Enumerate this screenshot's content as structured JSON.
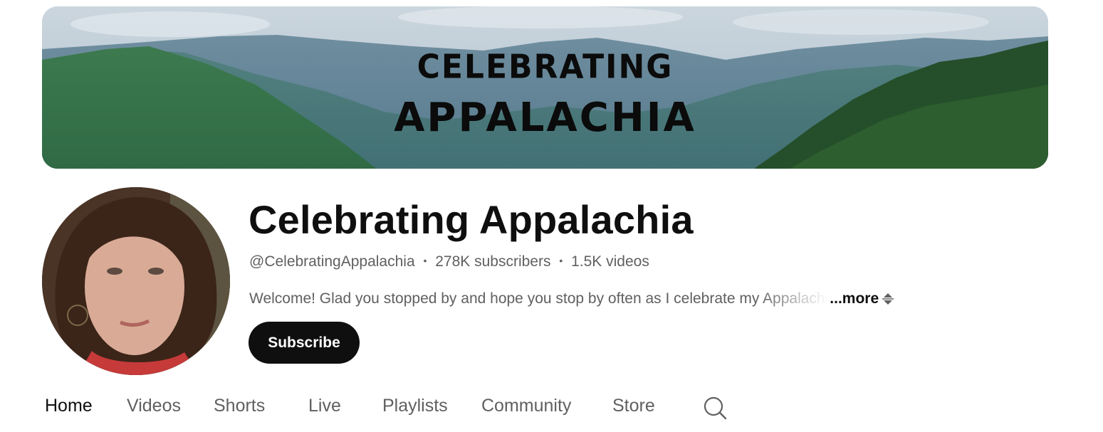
{
  "banner": {
    "line1": "CELEBRATING",
    "line2": "APPALACHIA"
  },
  "channel": {
    "name": "Celebrating Appalachia",
    "handle": "@CelebratingAppalachia",
    "subscribers": "278K subscribers",
    "videos": "1.5K videos",
    "separator": "•",
    "description": "Welcome! Glad you stopped by and hope you stop by often as I celebrate my Appalachi",
    "more_label": "...more"
  },
  "actions": {
    "subscribe_label": "Subscribe"
  },
  "tabs": [
    {
      "label": "Home",
      "active": true
    },
    {
      "label": "Videos",
      "active": false
    },
    {
      "label": "Shorts",
      "active": false
    },
    {
      "label": "Live",
      "active": false
    },
    {
      "label": "Playlists",
      "active": false
    },
    {
      "label": "Community",
      "active": false
    },
    {
      "label": "Store",
      "active": false
    }
  ],
  "icons": {
    "tab_search": "search-icon",
    "more_toggle": "expand-caret-icon"
  },
  "colors": {
    "primary_text": "#0f0f0f",
    "secondary_text": "#606060",
    "subscribe_bg": "#0f0f0f",
    "subscribe_text": "#ffffff"
  }
}
